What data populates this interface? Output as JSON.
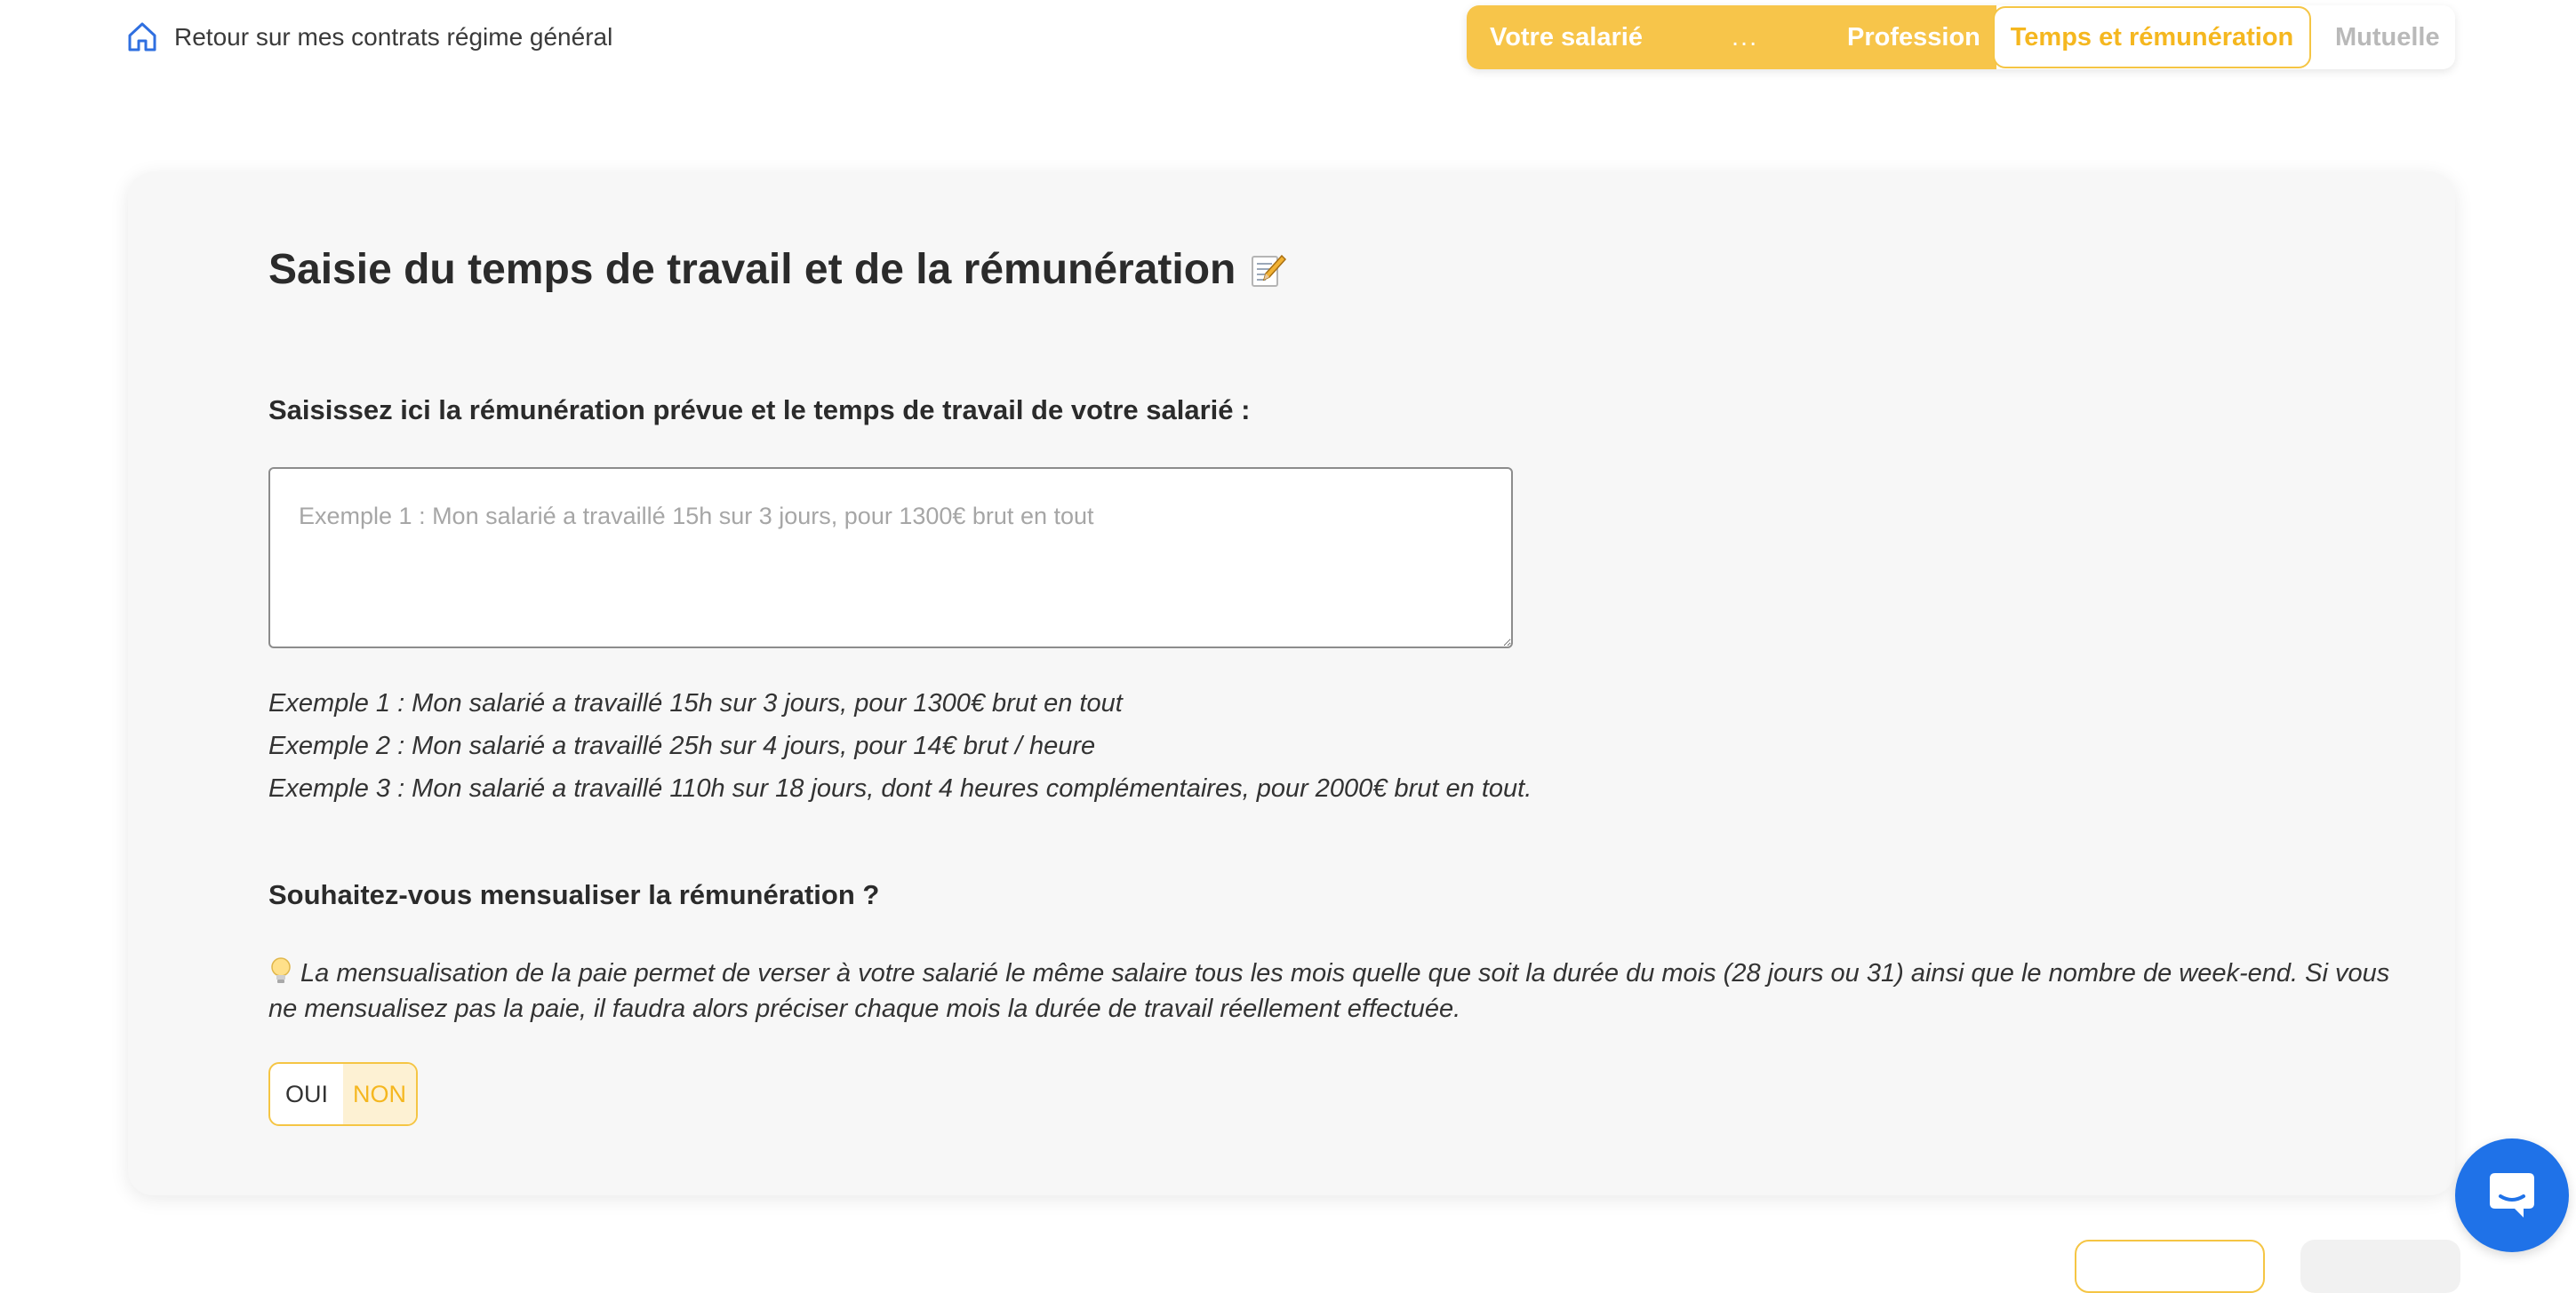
{
  "nav": {
    "back_label": "Retour sur mes contrats régime général"
  },
  "stepper": {
    "steps": [
      "Votre salarié",
      "...",
      "Profession",
      "Temps et rémunération",
      "Mutuelle"
    ],
    "current": "Temps et rémunération"
  },
  "main": {
    "title": "Saisie du temps de travail et de la rémunération",
    "remuneration_question": "Saisissez ici la rémunération prévue et le temps de travail de votre salarié :",
    "remuneration_placeholder": "Exemple 1 : Mon salarié a travaillé 15h sur 3 jours, pour 1300€ brut en tout",
    "remuneration_value": "",
    "examples": [
      "Exemple 1 : Mon salarié a travaillé 15h sur 3 jours, pour 1300€ brut en tout",
      "Exemple 2 : Mon salarié a travaillé 25h sur 4 jours, pour 14€ brut / heure",
      "Exemple 3 : Mon salarié a travaillé 110h sur 18 jours, dont 4 heures complémentaires, pour 2000€ brut en tout."
    ],
    "mensualisation_question": "Souhaitez-vous mensualiser la rémunération ?",
    "mensualisation_info": "La mensualisation de la paie permet de verser à votre salarié le même salaire tous les mois quelle que soit la durée du mois (28 jours ou 31) ainsi que le nombre de week-end. Si vous ne mensualisez pas la paie, il faudra alors préciser chaque mois la durée de travail réellement effectuée.",
    "toggle": {
      "yes_label": "OUI",
      "no_label": "NON",
      "selected": "NON"
    }
  },
  "colors": {
    "accent": "#f7c54a",
    "accent_text": "#f5b71f",
    "chat": "#1f72e8",
    "card_bg": "#f7f7f7"
  },
  "icons": [
    "home-icon",
    "memo-icon",
    "lightbulb-icon",
    "chat-bubble-icon"
  ]
}
